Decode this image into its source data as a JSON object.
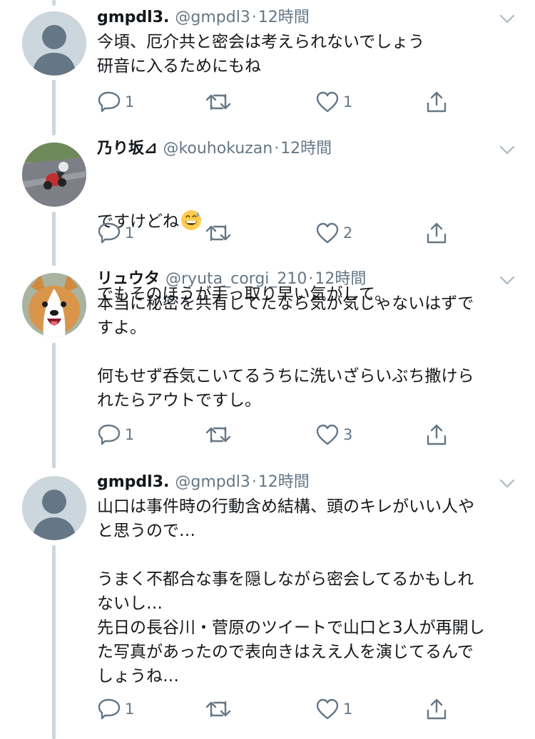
{
  "tweets": [
    {
      "name": "gmpdl3.",
      "handle": "@gmpdl3",
      "dot": "·",
      "time": "12時間",
      "lines": [
        "今頃、厄介共と密会は考えられないでしょう",
        "研音に入るためにもね"
      ],
      "reply_count": "1",
      "retweet_count": "",
      "like_count": "1"
    },
    {
      "name": "乃り坂⊿",
      "handle": "@kouhokuzan",
      "dot": "·",
      "time": "12時間",
      "line1": "ですけどね",
      "emoji": "grinning-sweat-emoji",
      "line2": "でもそのほうが手っ取り早い気がして。",
      "reply_count": "1",
      "retweet_count": "",
      "like_count": "2"
    },
    {
      "name": "リュウタ",
      "handle": "@ryuta_corgi_210",
      "dot": "·",
      "time": "12時間",
      "text": "本当に秘密を共有してたなら気が気じゃないはずで\nすよ。\n\n何もせず呑気こいてるうちに洗いざらいぶち撒けら\nれたらアウトですし。",
      "reply_count": "1",
      "retweet_count": "",
      "like_count": "3"
    },
    {
      "name": "gmpdl3.",
      "handle": "@gmpdl3",
      "dot": "·",
      "time": "12時間",
      "text": "山口は事件時の行動含め結構、頭のキレがいい人や\nと思うので…\n\nうまく不都合な事を隠しながら密会してるかもしれ\nないし…\n先日の長谷川・菅原のツイートで山口と3人が再開し\nた写真があったので表向きはええ人を演じてるんで\nしょうね…",
      "reply_count": "1",
      "retweet_count": "",
      "like_count": "1"
    }
  ],
  "colors": {
    "text": "#14171a",
    "secondary": "#657786",
    "thread_line": "#ccd6dd",
    "icon": "#657786"
  },
  "icons": [
    "reply-icon",
    "retweet-icon",
    "like-icon",
    "share-icon",
    "chevron-down-icon"
  ]
}
